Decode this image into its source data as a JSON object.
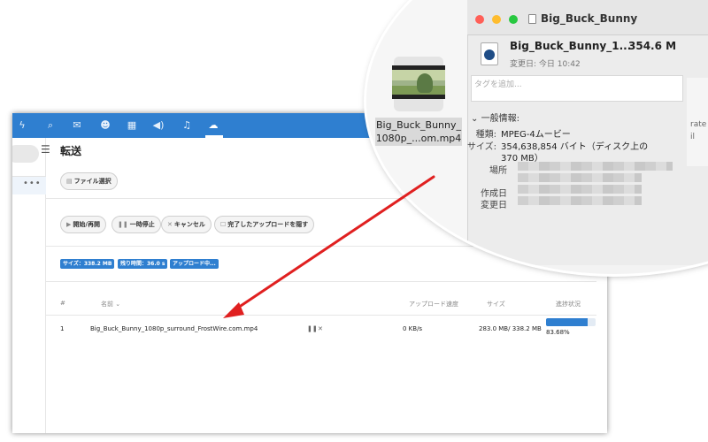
{
  "app": {
    "page_title": "転送",
    "toolbar": {
      "select_file": "ファイル選択",
      "start_resume": "開始/再開",
      "pause": "一時停止",
      "cancel": "キャンセル",
      "hide_completed": "完了したアップロードを隠す"
    },
    "status": {
      "size": "サイズ：338.2 MB",
      "remaining": "残り時間：36.0 s",
      "uploading": "アップロード中..."
    },
    "table": {
      "columns": {
        "num": "#",
        "name": "名前",
        "speed": "アップロード速度",
        "size": "サイズ",
        "progress": "進捗状況"
      },
      "rows": [
        {
          "num": "1",
          "name": "Big_Buck_Bunny_1080p_surround_FrostWire.com.mp4",
          "speed": "0 KB/s",
          "size": "283.0 MB/ 338.2 MB",
          "progress_pct": "83.68%",
          "progress_fraction": 0.8368
        }
      ]
    },
    "colors": {
      "accent": "#2f7fd0"
    }
  },
  "zoom": {
    "finder_filename_line1": "Big_Buck_Bunny_",
    "finder_filename_line2": "1080p_...om.mp4",
    "window_title": "Big_Buck_Bunny",
    "info_filename": "Big_Buck_Bunny_1...",
    "info_filesize": "354.6 M",
    "modified": "変更日: 今日 10:42",
    "tags_placeholder": "タグを追加...",
    "section_general": "一般情報:",
    "kind_label": "種類:",
    "kind_value": "MPEG-4ムービー",
    "size_label": "サイズ:",
    "size_value_line1": "354,638,854 バイト（ディスク上の",
    "size_value_line2": "370 MB）",
    "where_label": "場所",
    "created_label": "作成日",
    "modified_label": "変更日",
    "side_text1": "rate",
    "side_text2": "il"
  }
}
